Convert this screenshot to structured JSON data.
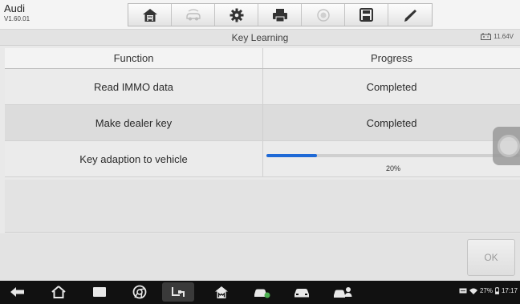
{
  "app": {
    "brand": "Audi",
    "version": "V1.60.01"
  },
  "toolbar": {
    "buttons": [
      {
        "icon": "home-icon"
      },
      {
        "icon": "vehicle-swap-icon"
      },
      {
        "icon": "settings-gear-icon"
      },
      {
        "icon": "printer-icon"
      },
      {
        "icon": "help-icon"
      },
      {
        "icon": "save-icon"
      },
      {
        "icon": "edit-pen-icon"
      }
    ]
  },
  "titlebar": {
    "title": "Key Learning",
    "battery_voltage": "11.64V"
  },
  "table": {
    "headers": {
      "function": "Function",
      "progress": "Progress"
    },
    "rows": [
      {
        "function": "Read IMMO data",
        "progress": "Completed"
      },
      {
        "function": "Make dealer key",
        "progress": "Completed"
      },
      {
        "function": "Key adaption to vehicle",
        "progress_label": "20%",
        "progress_value": 0.2
      }
    ]
  },
  "actions": {
    "ok_label": "OK"
  },
  "statusbar": {
    "battery": "27%",
    "time": "17:17"
  },
  "colors": {
    "accent": "#1e69d6",
    "navbar": "#111111"
  }
}
